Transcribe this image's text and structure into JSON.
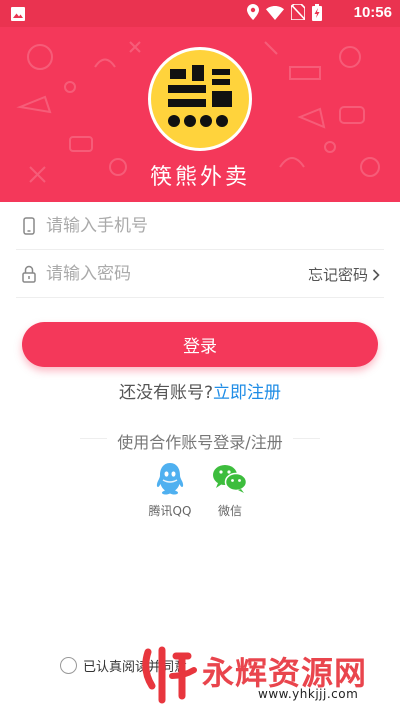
{
  "status_bar": {
    "time": "10:56",
    "icons": [
      "gallery-icon",
      "location-icon",
      "wifi-icon",
      "no-sim-icon",
      "battery-charging-icon"
    ]
  },
  "header": {
    "background_color": "#f4385a",
    "logo_glyph": "熊",
    "app_name": "筷熊外卖"
  },
  "login_form": {
    "phone_placeholder": "请输入手机号",
    "password_placeholder": "请输入密码",
    "forgot_label": "忘记密码",
    "submit_label": "登录"
  },
  "register": {
    "prompt": "还没有账号?",
    "link_label": "立即注册",
    "link_color": "#1e8ce6"
  },
  "social_login": {
    "title": "使用合作账号登录/注册",
    "providers": [
      {
        "icon": "qq-icon",
        "label": "腾讯QQ",
        "color": "#4fb0f0"
      },
      {
        "icon": "wechat-icon",
        "label": "微信",
        "color": "#3dbd3d"
      }
    ]
  },
  "agreement": {
    "checked": false,
    "text": "已认真阅读并同意"
  },
  "watermark": {
    "text": "永辉资源网",
    "url": "www.yhkjjj.com"
  }
}
